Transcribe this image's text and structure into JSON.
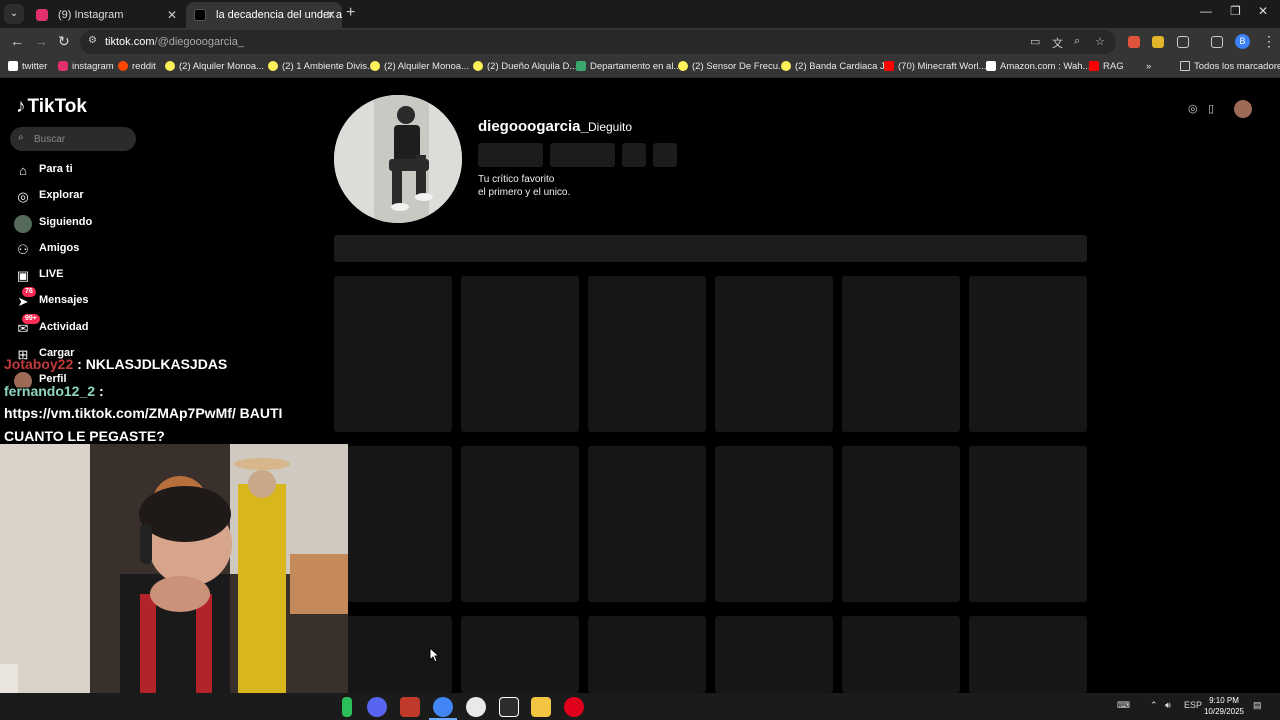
{
  "browser": {
    "tabs": [
      {
        "label": "(9) Instagram",
        "active": false
      },
      {
        "label": "la decadencia del under argent",
        "active": true
      }
    ],
    "url_host": "tiktok.com",
    "url_path": "/@diegooogarcia_",
    "bookmarks": [
      {
        "label": "twitter",
        "icon": "x-icon",
        "color": "#ffffff"
      },
      {
        "label": "instagram",
        "icon": "instagram-icon",
        "color": "#e1306c"
      },
      {
        "label": "reddit",
        "icon": "reddit-icon",
        "color": "#ff4500"
      },
      {
        "label": "(2) Alquiler Monoa...",
        "icon": "mercadolibre-icon",
        "color": "#fff159"
      },
      {
        "label": "(2) 1 Ambiente Divis...",
        "icon": "mercadolibre-icon",
        "color": "#fff159"
      },
      {
        "label": "(2) Alquiler Monoa...",
        "icon": "mercadolibre-icon",
        "color": "#fff159"
      },
      {
        "label": "(2) Dueño Alquila D...",
        "icon": "mercadolibre-icon",
        "color": "#fff159"
      },
      {
        "label": "Departamento en al...",
        "icon": "house-icon",
        "color": "#3aa76d"
      },
      {
        "label": "(2) Sensor De Frecu...",
        "icon": "mercadolibre-icon",
        "color": "#fff159"
      },
      {
        "label": "(2) Banda Cardiaca J...",
        "icon": "mercadolibre-icon",
        "color": "#fff159"
      },
      {
        "label": "(70) Minecraft Worl...",
        "icon": "youtube-icon",
        "color": "#ff0000"
      },
      {
        "label": "Amazon.com : Wah...",
        "icon": "amazon-icon",
        "color": "#ffffff"
      },
      {
        "label": "RAG",
        "icon": "youtube-icon",
        "color": "#ff0000"
      }
    ],
    "all_bookmarks": "Todos los marcadores",
    "profile_initial": "B"
  },
  "tiktok": {
    "logo": "TikTok",
    "search_placeholder": "Buscar",
    "nav": [
      {
        "label": "Para ti",
        "icon": "home-icon"
      },
      {
        "label": "Explorar",
        "icon": "compass-icon"
      },
      {
        "label": "Siguiendo",
        "icon": "following-avatar-icon"
      },
      {
        "label": "Amigos",
        "icon": "friends-icon"
      },
      {
        "label": "LIVE",
        "icon": "live-icon"
      },
      {
        "label": "Mensajes",
        "icon": "messages-icon",
        "badge": "76"
      },
      {
        "label": "Actividad",
        "icon": "activity-icon",
        "badge": "99+"
      },
      {
        "label": "Cargar",
        "icon": "upload-icon"
      },
      {
        "label": "Perfil",
        "icon": "profile-avatar-icon"
      }
    ],
    "profile": {
      "username": "diegooogarcia_",
      "nickname": "Dieguito",
      "bio_line1": "Tu crítico favorito",
      "bio_line2": "el primero y el unico."
    }
  },
  "stream_chat": {
    "line1_user": "Jotaboy22",
    "line1_msg": ": NKLASJDLKASJDAS",
    "line2_user": "fernando12_2",
    "line2_msg": ":",
    "line3": "https://vm.tiktok.com/ZMAp7PwMf/ BAUTI",
    "line4": "CUANTO LE PEGASTE?"
  },
  "taskbar": {
    "lang": "ESP",
    "time": "9:10 PM",
    "date": "10/29/2025"
  }
}
